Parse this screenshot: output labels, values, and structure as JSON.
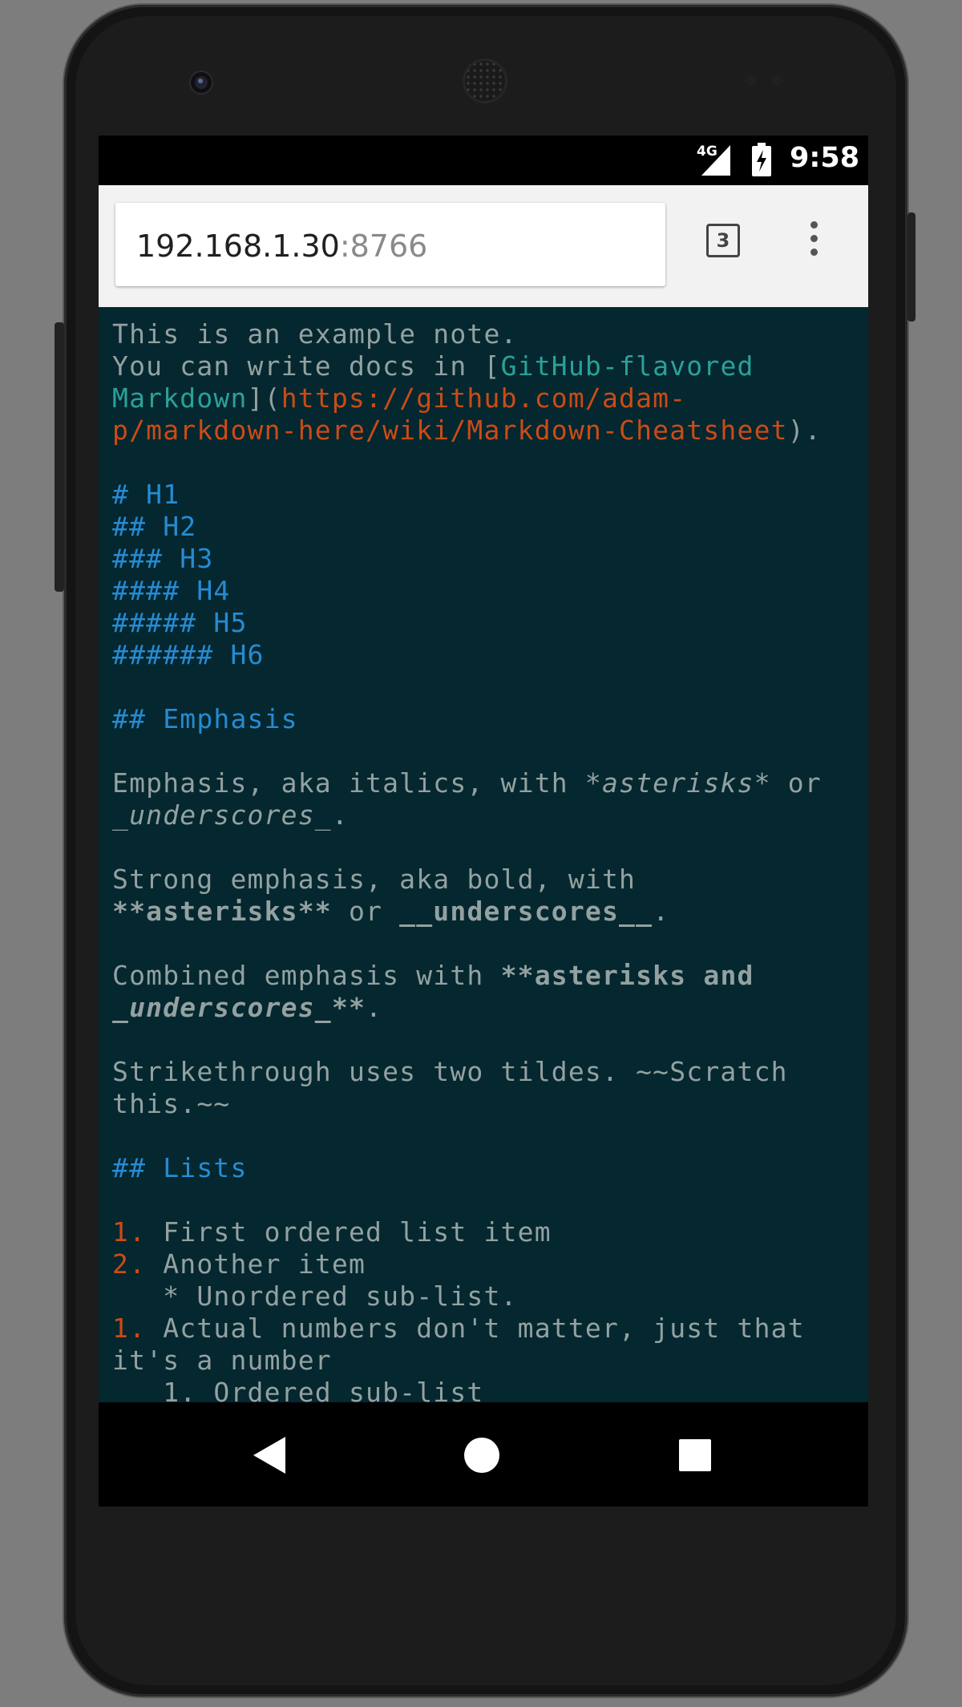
{
  "status_bar": {
    "network": "4G",
    "time": "9:58"
  },
  "browser": {
    "url_host": "192.168.1.30",
    "url_port": ":8766",
    "tab_count": "3"
  },
  "editor": {
    "lines": [
      [
        {
          "t": "This is an example note.",
          "c": "plain"
        }
      ],
      [
        {
          "t": "You can write docs in [",
          "c": "plain"
        },
        {
          "t": "GitHub-flavored",
          "c": "linktext"
        }
      ],
      [
        {
          "t": "Markdown",
          "c": "linktext"
        },
        {
          "t": "](",
          "c": "plain"
        },
        {
          "t": "https://github.com/adam-",
          "c": "url"
        }
      ],
      [
        {
          "t": "p/markdown-here/wiki/Markdown-Cheatsheet",
          "c": "url"
        },
        {
          "t": ").",
          "c": "plain"
        }
      ],
      [],
      [
        {
          "t": "# H1",
          "c": "heading"
        }
      ],
      [
        {
          "t": "## H2",
          "c": "heading"
        }
      ],
      [
        {
          "t": "### H3",
          "c": "heading"
        }
      ],
      [
        {
          "t": "#### H4",
          "c": "heading"
        }
      ],
      [
        {
          "t": "##### H5",
          "c": "heading"
        }
      ],
      [
        {
          "t": "###### H6",
          "c": "heading"
        }
      ],
      [],
      [
        {
          "t": "## Emphasis",
          "c": "heading"
        }
      ],
      [],
      [
        {
          "t": "Emphasis, aka italics, with ",
          "c": "plain"
        },
        {
          "t": "*asterisks*",
          "c": "em"
        },
        {
          "t": " or",
          "c": "plain"
        }
      ],
      [
        {
          "t": "_underscores_",
          "c": "em"
        },
        {
          "t": ".",
          "c": "plain"
        }
      ],
      [],
      [
        {
          "t": "Strong emphasis, aka bold, with",
          "c": "plain"
        }
      ],
      [
        {
          "t": "**asterisks**",
          "c": "strong"
        },
        {
          "t": " or ",
          "c": "plain"
        },
        {
          "t": "__underscores__",
          "c": "strong"
        },
        {
          "t": ".",
          "c": "plain"
        }
      ],
      [],
      [
        {
          "t": "Combined emphasis with ",
          "c": "plain"
        },
        {
          "t": "**asterisks and",
          "c": "strong"
        }
      ],
      [
        {
          "t": "_underscores_",
          "c": "strong em"
        },
        {
          "t": "**",
          "c": "strong"
        },
        {
          "t": ".",
          "c": "plain"
        }
      ],
      [],
      [
        {
          "t": "Strikethrough uses two tildes. ~~Scratch",
          "c": "plain"
        }
      ],
      [
        {
          "t": "this.~~",
          "c": "plain"
        }
      ],
      [],
      [
        {
          "t": "## Lists",
          "c": "heading"
        }
      ],
      [],
      [
        {
          "t": "1.",
          "c": "num"
        },
        {
          "t": " First ordered list item",
          "c": "plain"
        }
      ],
      [
        {
          "t": "2.",
          "c": "num"
        },
        {
          "t": " Another item",
          "c": "plain"
        }
      ],
      [
        {
          "t": "   * Unordered sub-list.",
          "c": "plain"
        }
      ],
      [
        {
          "t": "1.",
          "c": "num"
        },
        {
          "t": " Actual numbers don't matter, just that",
          "c": "plain"
        }
      ],
      [
        {
          "t": "it's a number",
          "c": "plain"
        }
      ],
      [
        {
          "t": "   1. Ordered sub-list",
          "c": "plain"
        }
      ]
    ]
  },
  "nav_bar": {
    "buttons": [
      "back-icon",
      "home-icon",
      "recents-icon"
    ]
  },
  "colors": {
    "editor_bg": "#05272f",
    "plain_text": "#93a1a1",
    "heading": "#268bd2",
    "link_text": "#2aa198",
    "url": "#cb4b16"
  }
}
